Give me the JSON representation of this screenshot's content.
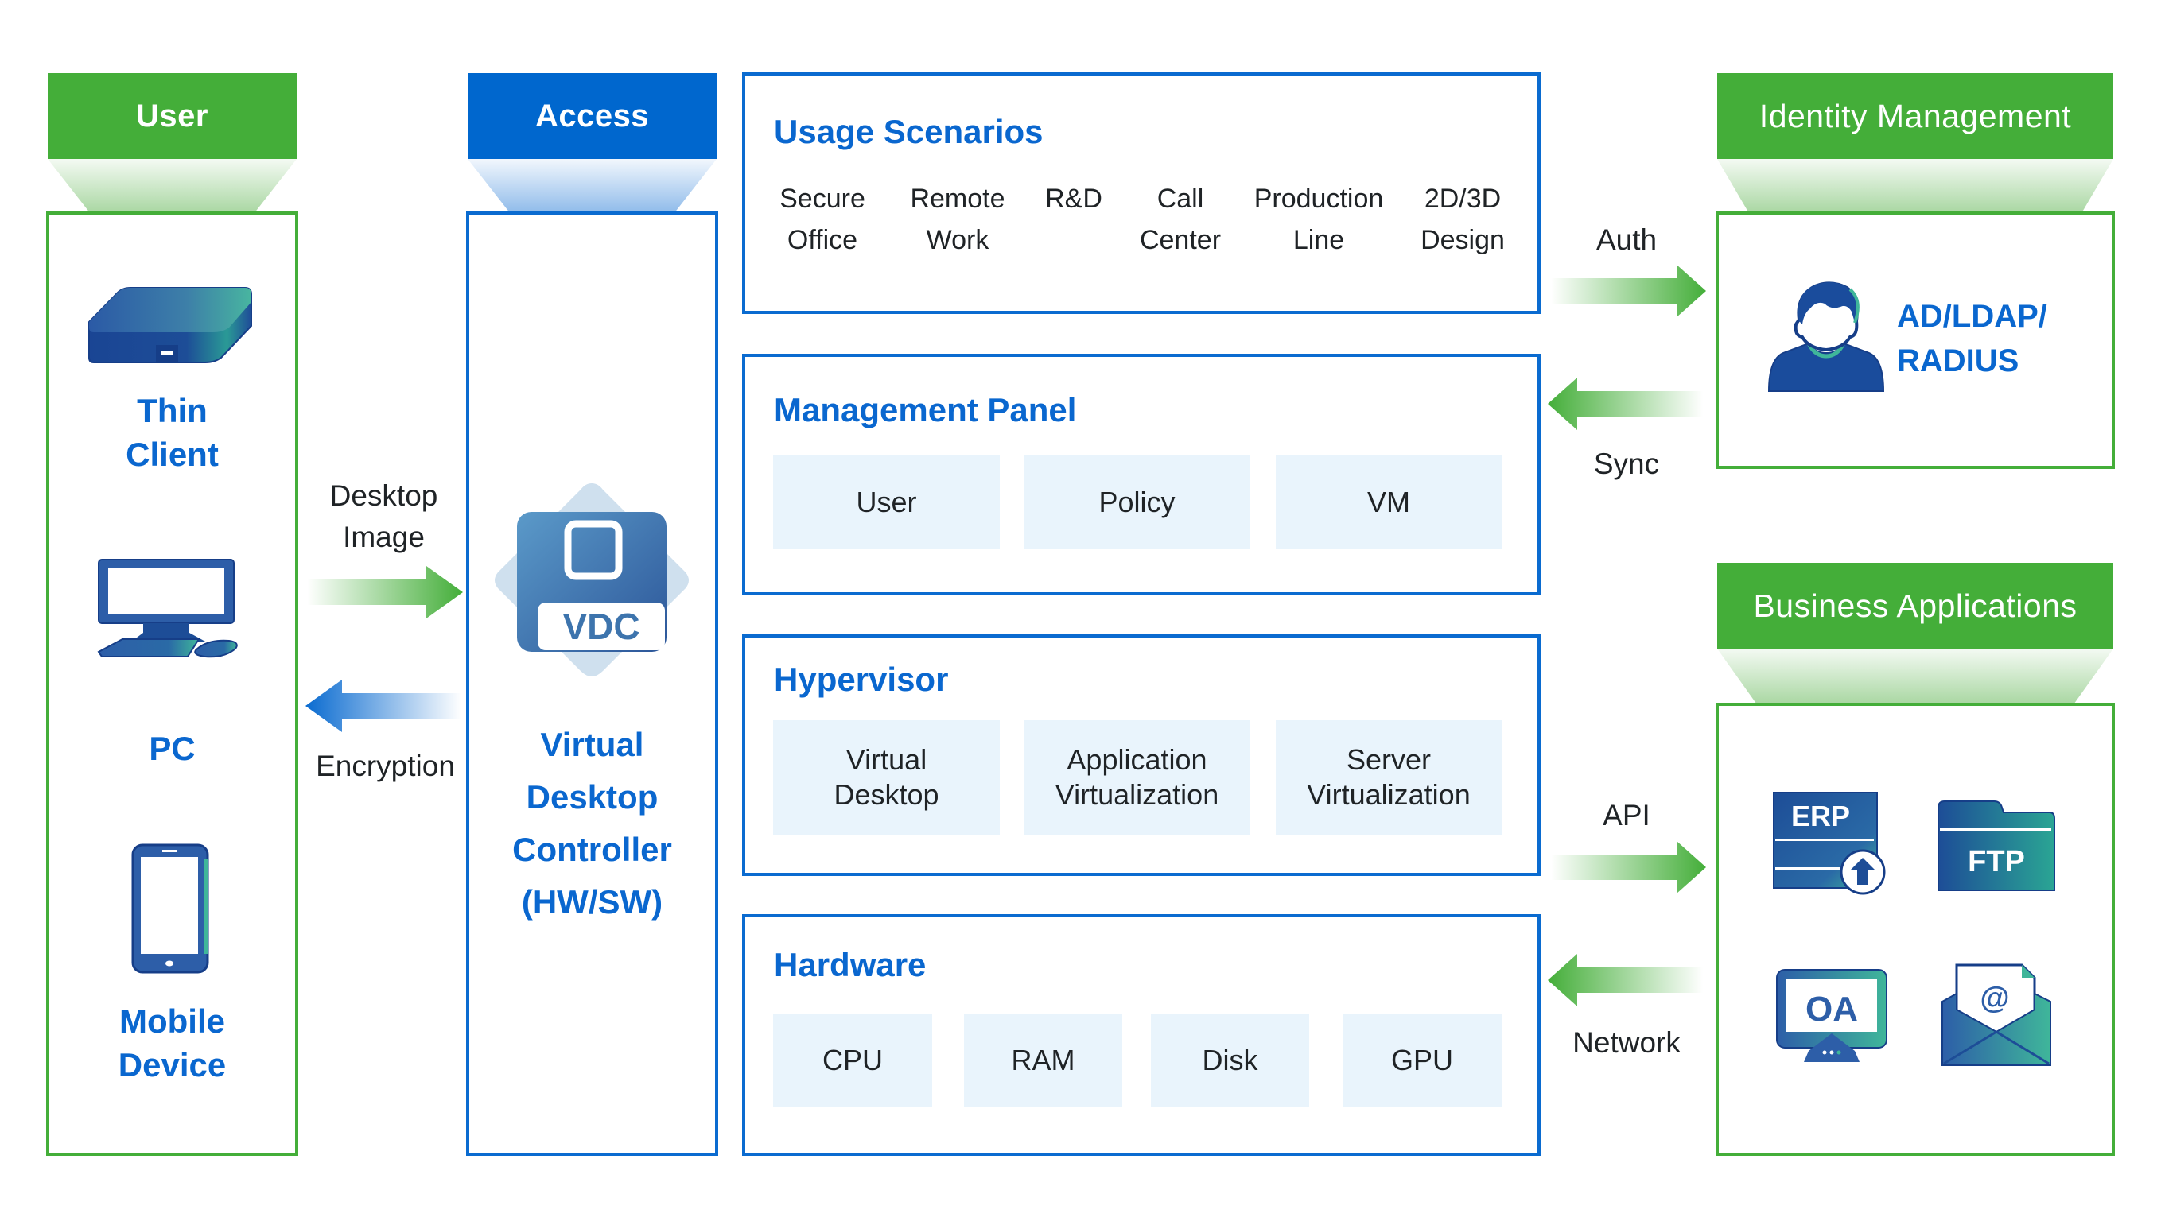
{
  "columns": {
    "user": {
      "header": "User",
      "devices": [
        {
          "icon": "thin-client-icon",
          "label_lines": [
            "Thin",
            "Client"
          ]
        },
        {
          "icon": "pc-icon",
          "label_lines": [
            "PC"
          ]
        },
        {
          "icon": "mobile-device-icon",
          "label_lines": [
            "Mobile",
            "Device"
          ]
        }
      ]
    },
    "access": {
      "header": "Access",
      "vdc_badge": "VDC",
      "label_lines": [
        "Virtual",
        "Desktop",
        "Controller",
        "(HW/SW)"
      ]
    },
    "identity": {
      "header": "Identity Management",
      "label_lines": [
        "AD/LDAP/",
        "RADIUS"
      ]
    },
    "business": {
      "header": "Business Applications",
      "apps": [
        "ERP",
        "FTP",
        "OA",
        "@"
      ]
    }
  },
  "flows": {
    "desktop_image": [
      "Desktop",
      "Image"
    ],
    "encryption": "Encryption",
    "auth": "Auth",
    "sync": "Sync",
    "api": "API",
    "network": "Network"
  },
  "layers": {
    "usage": {
      "title": "Usage Scenarios",
      "items": [
        [
          "Secure",
          "Office"
        ],
        [
          "Remote",
          "Work"
        ],
        [
          "R&D",
          ""
        ],
        [
          "Call",
          "Center"
        ],
        [
          "Production",
          "Line"
        ],
        [
          "2D/3D",
          "Design"
        ]
      ]
    },
    "management": {
      "title": "Management Panel",
      "items": [
        "User",
        "Policy",
        "VM"
      ]
    },
    "hypervisor": {
      "title": "Hypervisor",
      "items": [
        [
          "Virtual",
          "Desktop"
        ],
        [
          "Application",
          "Virtualization"
        ],
        [
          "Server",
          "Virtualization"
        ]
      ]
    },
    "hardware": {
      "title": "Hardware",
      "items": [
        "CPU",
        "RAM",
        "Disk",
        "GPU"
      ]
    }
  },
  "colors": {
    "green": "#44ae39",
    "blue": "#0067ce",
    "chip_bg": "#e9f4fc",
    "icon_dark": "#1a4c9c",
    "icon_teal": "#3fb69a"
  }
}
